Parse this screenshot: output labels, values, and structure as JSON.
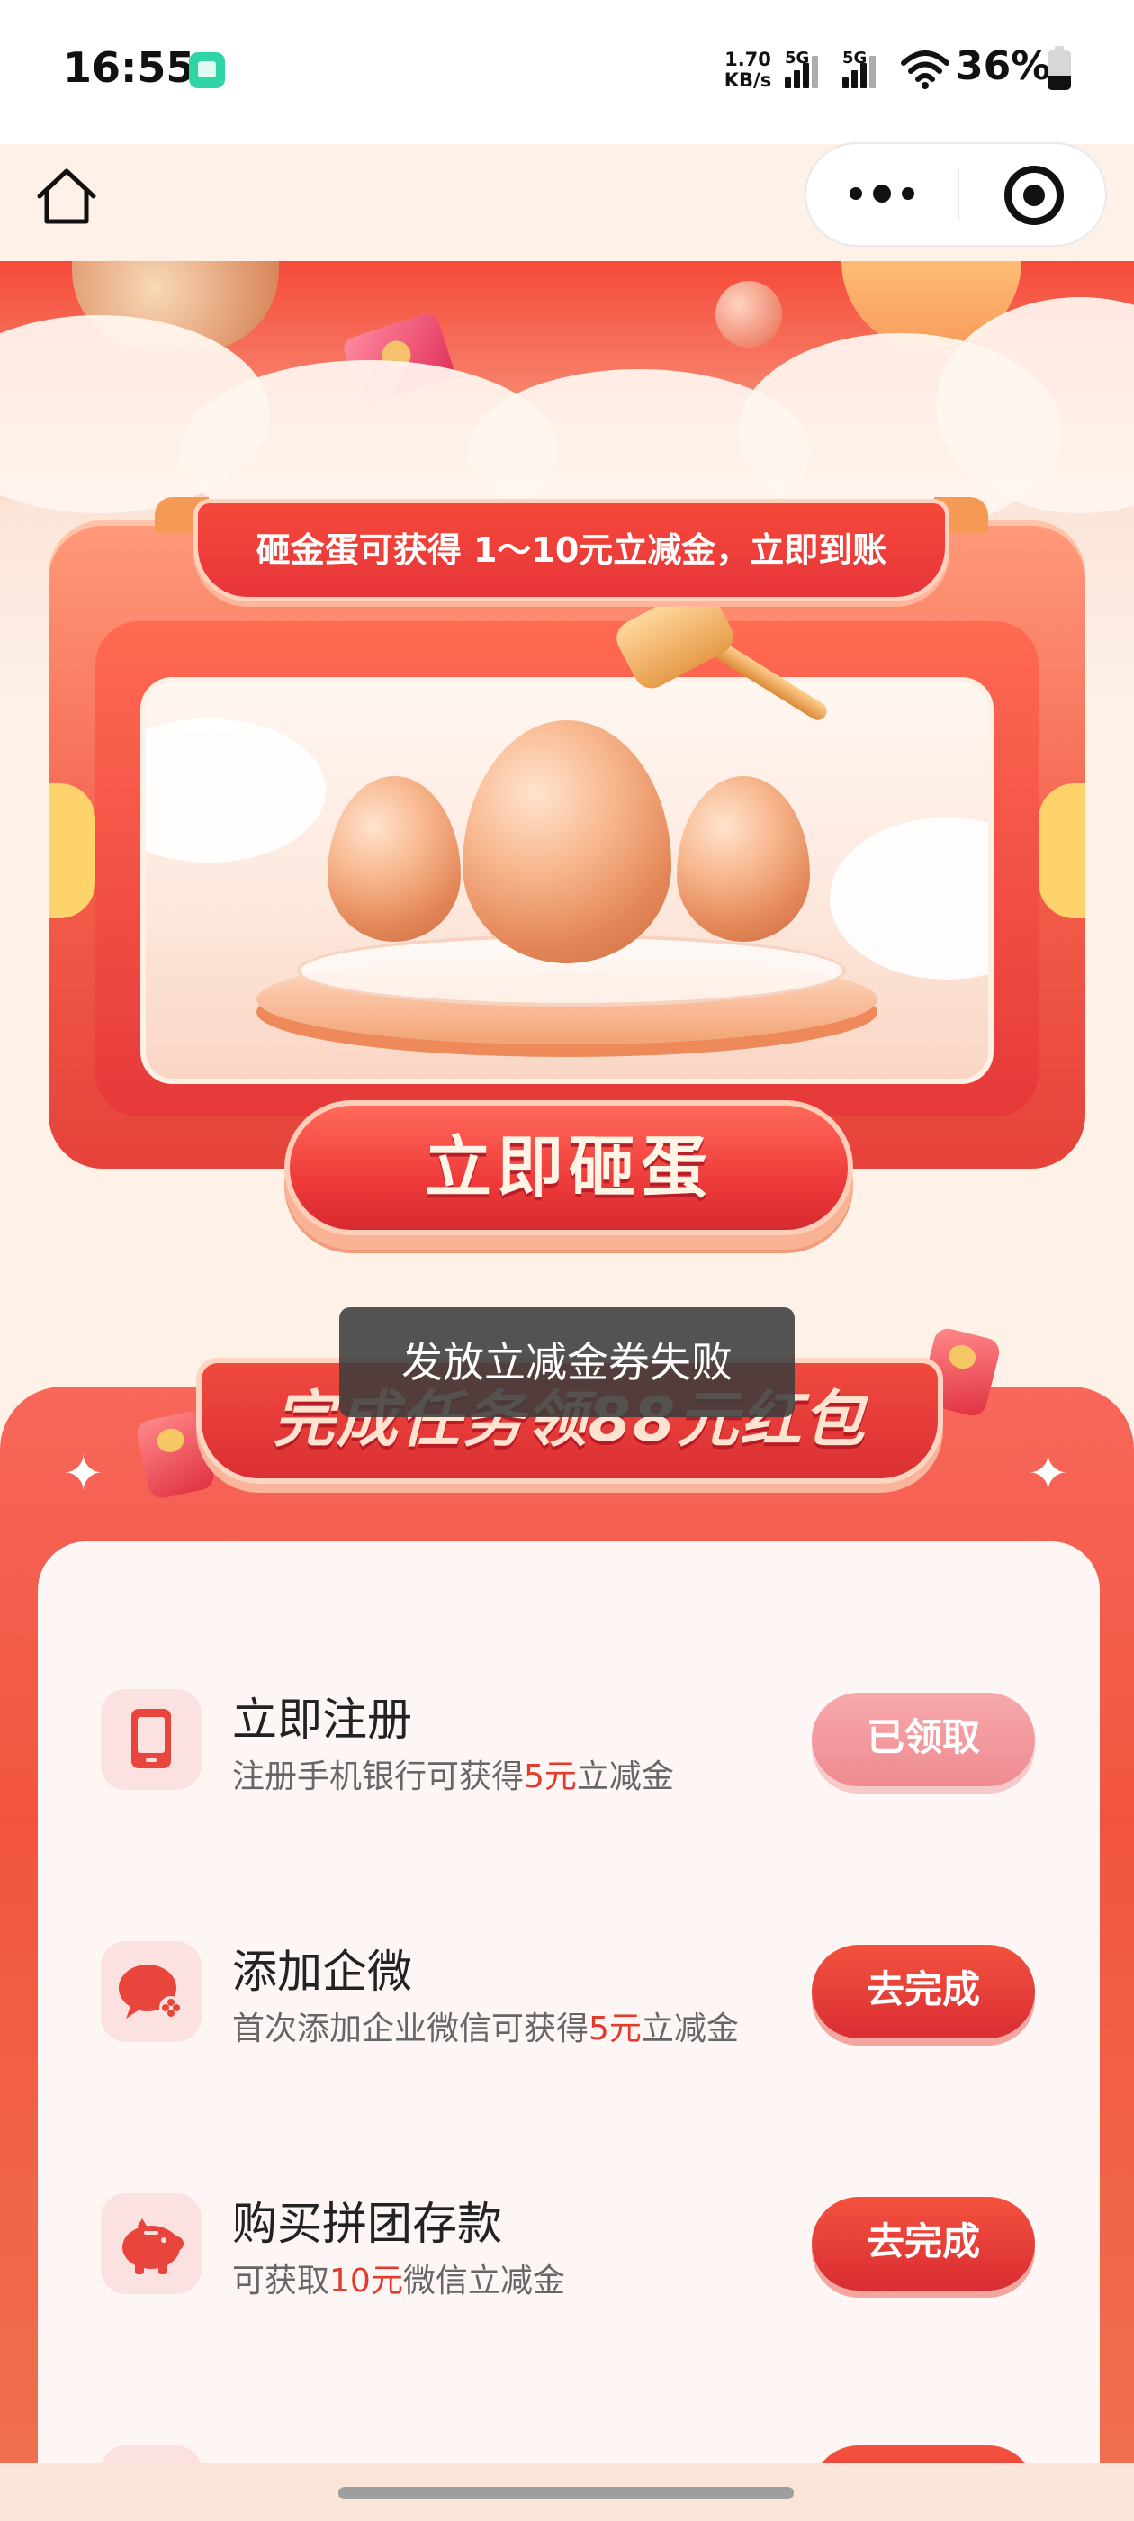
{
  "status_bar": {
    "time": "16:55",
    "net_speed_value": "1.70",
    "net_speed_unit": "KB/s",
    "sim1_type": "5G",
    "sim2_type": "5G",
    "battery": "36%",
    "app_icon": "wechat-app-icon",
    "wifi_icon": "wifi-icon"
  },
  "nav": {
    "home_icon": "home-icon",
    "more_icon": "more-dots-icon",
    "close_icon": "mini-program-close-icon"
  },
  "hero": {
    "banner_text": "砸金蛋可获得 1～10元立减金，立即到账",
    "action_label": "立即砸蛋",
    "accent_color": "#e8353a",
    "gold_color": "#f8b88f"
  },
  "toast": {
    "message": "发放立减金券失败"
  },
  "tasks": {
    "title": "完成任务领88元红包",
    "items": [
      {
        "name": "立即注册",
        "desc_before": "注册手机银行可获得",
        "desc_highlight": "5元",
        "desc_after": "立减金",
        "button": "已领取",
        "icon": "phone-icon"
      },
      {
        "name": "添加企微",
        "desc_before": "首次添加企业微信可获得",
        "desc_highlight": "5元",
        "desc_after": "立减金",
        "button": "去完成",
        "icon": "wecom-icon"
      },
      {
        "name": "购买拼团存款",
        "desc_before": "可获取",
        "desc_highlight": "10元",
        "desc_after": "微信立减金",
        "button": "去完成",
        "icon": "piggy-bank-icon"
      }
    ],
    "highlight_color": "#e23b2b"
  }
}
